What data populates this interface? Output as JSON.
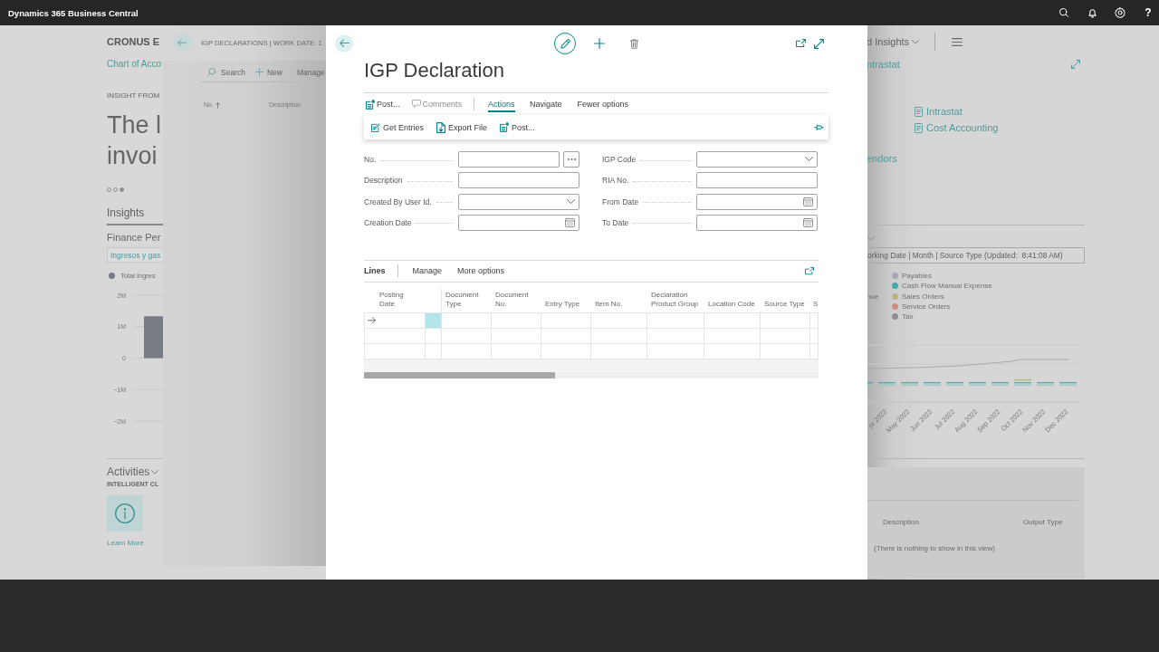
{
  "app_bar": {
    "title": "Dynamics 365 Business Central",
    "help": "?"
  },
  "role_center": {
    "company": "CRONUS E",
    "nav_link": "Chart of Acco",
    "insight": {
      "heading": "INSIGHT FROM",
      "headline": [
        "The l",
        "invoi"
      ],
      "pages": [
        {
          "selected": false
        },
        {
          "selected": false
        },
        {
          "selected": true
        }
      ]
    },
    "tabs": [
      {
        "label": "Insights",
        "selected": true
      }
    ],
    "finance": {
      "title": "Finance Per",
      "view": "Ingresos y gas",
      "chart_data": {
        "type": "bar",
        "series": [
          {
            "name": "Total Ingres",
            "color": "#777b84",
            "values": [
              1330000
            ]
          }
        ],
        "ylim": [
          -2000000,
          2000000
        ],
        "yticks": [
          {
            "value": 2000000,
            "label": "2M"
          },
          {
            "value": 1000000,
            "label": "1M"
          },
          0,
          {
            "value": -1000000,
            "label": "−1M"
          },
          {
            "value": -2000000,
            "label": "−2M"
          }
        ],
        "grid": true
      }
    },
    "activities": {
      "title": "Activities",
      "subtitle": "INTELLIGENT CL",
      "tile_link": "Learn More"
    },
    "menu_label": "d Insights",
    "link": "ntrastat",
    "reports": [
      "Intrastat",
      "Cost Accounting"
    ],
    "vendors_link": "endors",
    "cash_flow": {
      "filter": "orking Date | Month | Source Type (Updated:  8:41:08 AM)",
      "legend_fragment": "nue",
      "legend": [
        {
          "label": "Payables",
          "color": "#a9a8b0"
        },
        {
          "label": "Cash Flow Manual Expense",
          "color": "#44a8a8"
        },
        {
          "label": "Sales Orders",
          "color": "#b9b57f"
        },
        {
          "label": "Service Orders",
          "color": "#d08c84"
        },
        {
          "label": "Tax",
          "color": "#8e9095"
        }
      ],
      "months": [
        "pr 2022",
        "May 2022",
        "Jun 2022",
        "Jul 2022",
        "Aug 2022",
        "Sep 2022",
        "Oct 2022",
        "Nov 2022",
        "Dec 2022"
      ]
    },
    "output_table": {
      "columns": [
        "Description",
        "Output Type"
      ],
      "empty_text": "(There is nothing to show in this view)"
    }
  },
  "list_page": {
    "title": "IGP DECLARATIONS | WORK DATE: 1",
    "actions": [
      {
        "kind": "search",
        "label": "Search"
      },
      {
        "kind": "new",
        "label": "New"
      },
      {
        "kind": "menu",
        "label": "Manage"
      }
    ],
    "columns": [
      {
        "label": "No.",
        "sorted": true
      },
      {
        "label": "Description",
        "sorted": false
      }
    ]
  },
  "dialog": {
    "title": "IGP Declaration",
    "actions": [
      {
        "kind": "post",
        "label": "Post...",
        "disabled": false
      },
      {
        "kind": "comments",
        "label": "Comments",
        "disabled": true
      }
    ],
    "tabs": [
      {
        "label": "Actions",
        "selected": true
      },
      {
        "label": "Navigate",
        "selected": false
      }
    ],
    "options_toggle": "Fewer options",
    "menu": [
      {
        "kind": "get-entries",
        "label": "Get Entries"
      },
      {
        "kind": "export",
        "label": "Export File"
      },
      {
        "kind": "post",
        "label": "Post..."
      }
    ],
    "fields": {
      "left": [
        {
          "label": "No.",
          "kind": "assist"
        },
        {
          "label": "Description",
          "kind": "text"
        },
        {
          "label": "Created By User Id.",
          "kind": "lookup"
        },
        {
          "label": "Creation Date",
          "kind": "date"
        }
      ],
      "right": [
        {
          "label": "IGP Code",
          "kind": "lookup"
        },
        {
          "label": "RIA No.",
          "kind": "text"
        },
        {
          "label": "From Date",
          "kind": "date"
        },
        {
          "label": "To Date",
          "kind": "date"
        }
      ]
    },
    "lines": {
      "title": "Lines",
      "actions": [
        "Manage",
        "More options"
      ],
      "columns": [
        "Posting Date",
        "Document Type",
        "Document No.",
        "Entry Type",
        "Item No.",
        "Declaration Product Group",
        "Location Code",
        "Source Type",
        "S"
      ],
      "rows": [
        {
          "selected": true
        },
        {
          "selected": false
        },
        {
          "selected": false
        }
      ]
    }
  }
}
